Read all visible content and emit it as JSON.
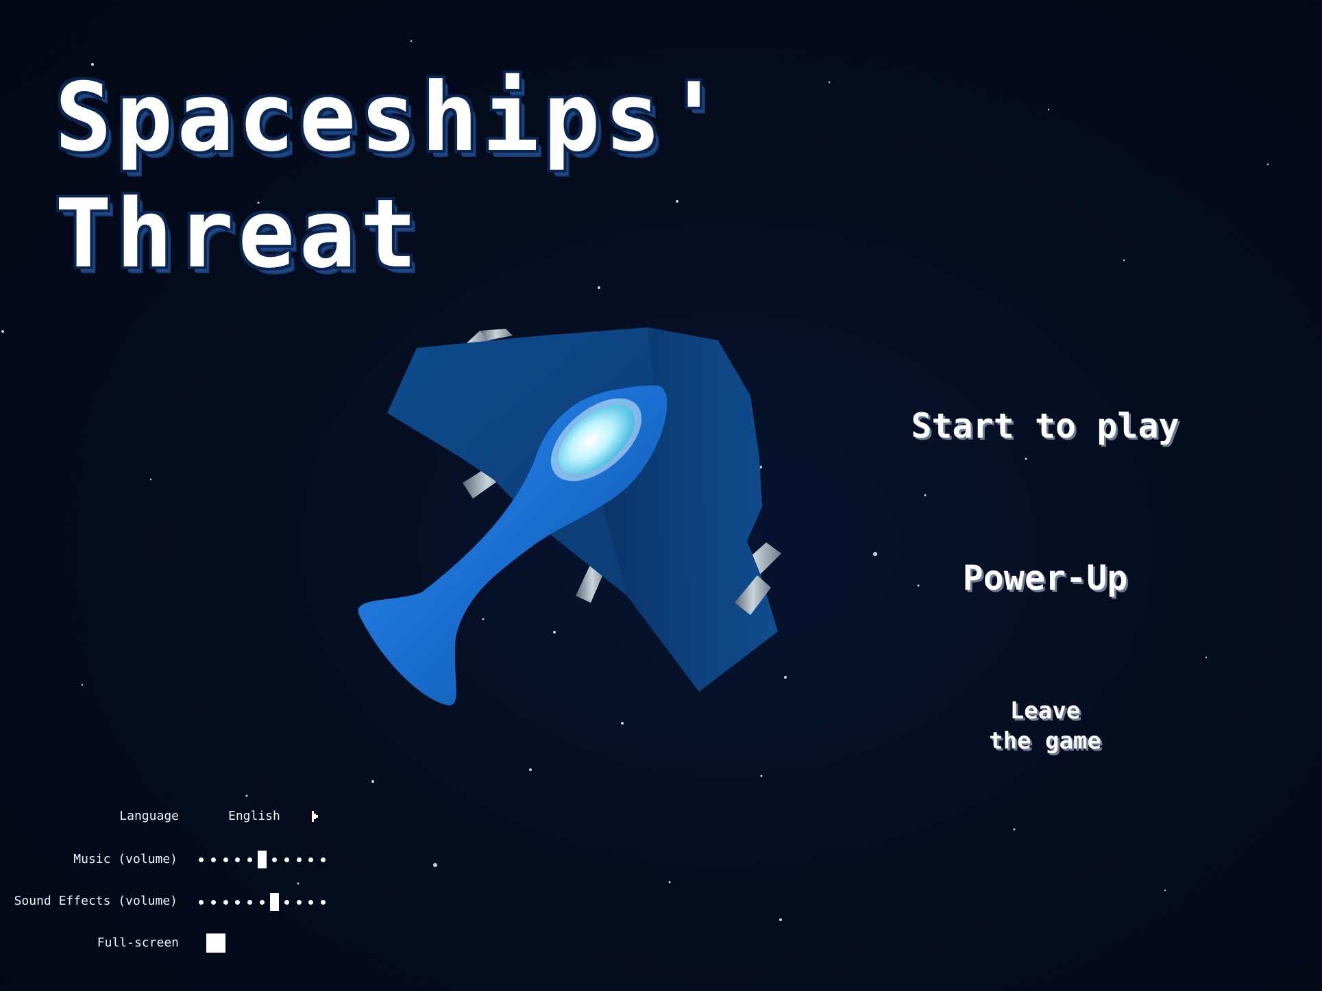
{
  "game": {
    "title_line1": "Spaceships'",
    "title_line2": "Threat"
  },
  "menu": {
    "start": "Start to play",
    "powerup": "Power-Up",
    "leave_line1": "Leave",
    "leave_line2": "the game"
  },
  "settings": {
    "language": {
      "label": "Language",
      "value": "English",
      "arrow_icon": "arrow-right-icon"
    },
    "music": {
      "label": "Music (volume)",
      "level": 0.45,
      "steps": 11
    },
    "sound_effects": {
      "label": "Sound Effects (volume)",
      "level": 0.55,
      "steps": 11
    },
    "fullscreen": {
      "label": "Full-screen",
      "checked": false
    }
  },
  "colors": {
    "background": "#040a18",
    "ship_body": "#1a6fd0",
    "ship_wing": "#0f4c8f",
    "cockpit": "#bff4ff",
    "title_outline": "#0c2550",
    "text": "#ffffff"
  },
  "icons": {
    "ship": "spaceship-icon",
    "language_arrow": "arrow-right-icon"
  }
}
